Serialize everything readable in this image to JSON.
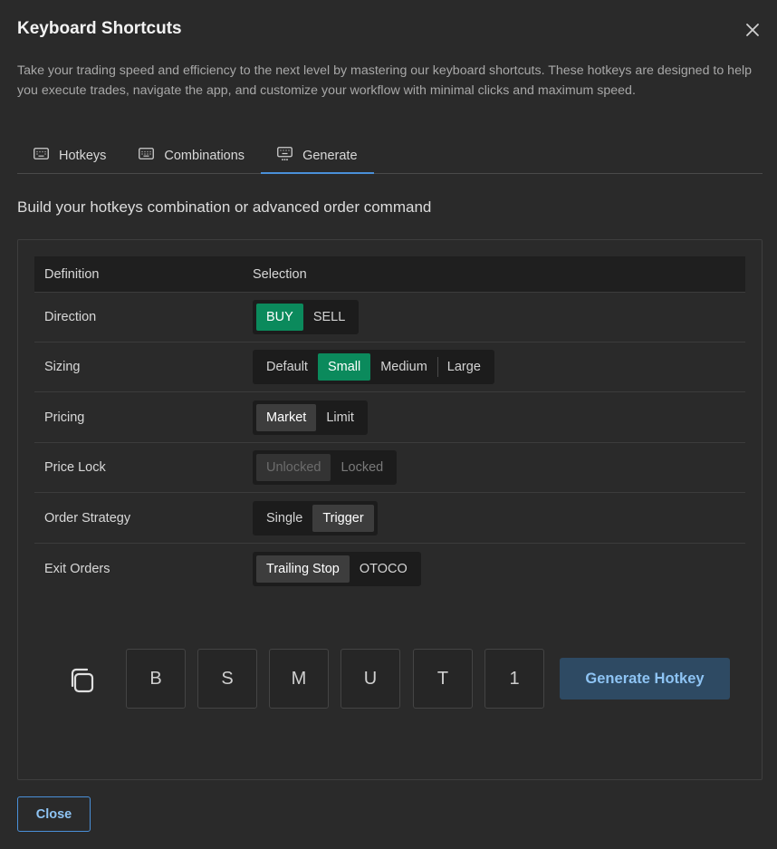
{
  "dialog": {
    "title": "Keyboard Shortcuts",
    "description": "Take your trading speed and efficiency to the next level by mastering our keyboard shortcuts. These hotkeys are designed to help you execute trades, navigate the app, and customize your workflow with minimal clicks and maximum speed."
  },
  "tabs": [
    {
      "label": "Hotkeys",
      "icon": "keyboard-icon",
      "active": false
    },
    {
      "label": "Combinations",
      "icon": "keyboard-icon",
      "active": false
    },
    {
      "label": "Generate",
      "icon": "keyboard-settings-icon",
      "active": true
    }
  ],
  "generate": {
    "subtitle": "Build your hotkeys combination or advanced order command",
    "table": {
      "headers": [
        "Definition",
        "Selection"
      ],
      "rows": [
        {
          "label": "Direction",
          "options": [
            "BUY",
            "SELL"
          ],
          "selected": "BUY"
        },
        {
          "label": "Sizing",
          "options": [
            "Default",
            "Small",
            "Medium",
            "Large"
          ],
          "selected": "Small"
        },
        {
          "label": "Pricing",
          "options": [
            "Market",
            "Limit"
          ],
          "selected": "Market"
        },
        {
          "label": "Price Lock",
          "options": [
            "Unlocked",
            "Locked"
          ],
          "selected": "Unlocked",
          "disabled": true
        },
        {
          "label": "Order Strategy",
          "options": [
            "Single",
            "Trigger"
          ],
          "selected": "Trigger"
        },
        {
          "label": "Exit Orders",
          "options": [
            "Trailing Stop",
            "OTOCO"
          ],
          "selected": "Trailing Stop"
        }
      ]
    },
    "keys": [
      "B",
      "S",
      "M",
      "U",
      "T",
      "1"
    ],
    "generate_button": "Generate Hotkey"
  },
  "footer": {
    "close_label": "Close"
  },
  "colors": {
    "accent": "#4a90d9",
    "selected_green": "#0b8a5c",
    "background": "#2a2a2a"
  }
}
